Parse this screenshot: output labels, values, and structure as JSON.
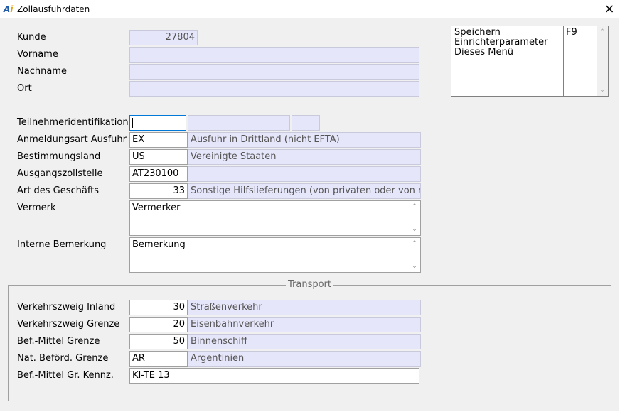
{
  "window": {
    "title": "Zollausfuhrdaten",
    "logo_a": "A",
    "logo_i": "i",
    "close_glyph": "×"
  },
  "menu": {
    "items": [
      "Speichern",
      "Einrichterparameter",
      "Dieses Menü"
    ],
    "shortcuts": [
      "F9",
      "",
      ""
    ]
  },
  "fields": {
    "kunde": {
      "label": "Kunde",
      "value": "27804"
    },
    "vorname": {
      "label": "Vorname",
      "value": ""
    },
    "nachname": {
      "label": "Nachname",
      "value": ""
    },
    "ort": {
      "label": "Ort",
      "value": ""
    },
    "teilnehmer": {
      "label": "Teilnehmeridentifikation",
      "value": ""
    },
    "anmeldungsart": {
      "label": "Anmeldungsart Ausfuhr",
      "code": "EX",
      "text": "Ausfuhr in Drittland (nicht EFTA)"
    },
    "bestimmungsland": {
      "label": "Bestimmungsland",
      "code": "US",
      "text": "Vereinigte Staaten"
    },
    "ausgangszollstelle": {
      "label": "Ausgangszollstelle",
      "code": "AT230100",
      "text": ""
    },
    "art_geschaeft": {
      "label": "Art des Geschäfts",
      "code": "33",
      "text": "Sonstige Hilfslieferungen (von privaten oder von ni"
    },
    "vermerk": {
      "label": "Vermerk",
      "value": "Vermerker"
    },
    "interne_bemerkung": {
      "label": "Interne Bemerkung",
      "value": "Bemerkung"
    }
  },
  "transport": {
    "legend": "Transport",
    "verkehrszweig_inland": {
      "label": "Verkehrszweig Inland",
      "code": "30",
      "text": "Straßenverkehr"
    },
    "verkehrszweig_grenze": {
      "label": "Verkehrszweig Grenze",
      "code": "20",
      "text": "Eisenbahnverkehr"
    },
    "bef_mittel_grenze": {
      "label": "Bef.-Mittel Grenze",
      "code": "50",
      "text": "Binnenschiff"
    },
    "nat_befoerd_grenze": {
      "label": "Nat. Beförd. Grenze",
      "code": "AR",
      "text": "Argentinien"
    },
    "bef_mittel_kennz": {
      "label": "Bef.-Mittel Gr. Kennz.",
      "value": "KI-TE 13"
    }
  }
}
